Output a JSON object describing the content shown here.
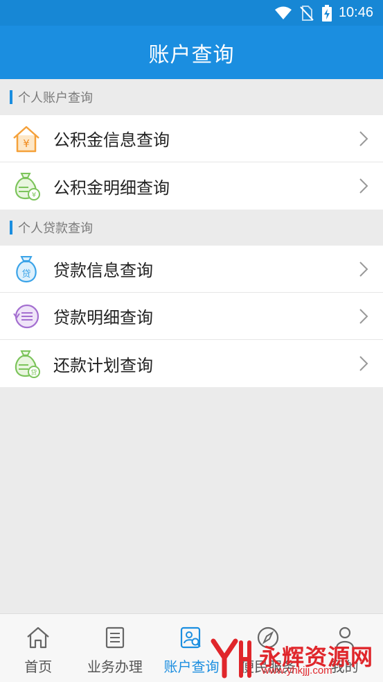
{
  "status_bar": {
    "time": "10:46",
    "icons": [
      "wifi-icon",
      "no-sim-icon",
      "battery-charging-icon"
    ]
  },
  "header": {
    "title": "账户查询"
  },
  "sections": [
    {
      "title": "个人账户查询",
      "items": [
        {
          "label": "公积金信息查询",
          "icon": "house-yuan-icon"
        },
        {
          "label": "公积金明细查询",
          "icon": "moneybag-yuan-icon"
        }
      ]
    },
    {
      "title": "个人贷款查询",
      "items": [
        {
          "label": "贷款信息查询",
          "icon": "loan-bag-icon"
        },
        {
          "label": "贷款明细查询",
          "icon": "list-circle-icon"
        },
        {
          "label": "还款计划查询",
          "icon": "moneybag-loan-icon"
        }
      ]
    }
  ],
  "tabbar": {
    "tabs": [
      {
        "label": "首页",
        "icon": "home-icon"
      },
      {
        "label": "业务办理",
        "icon": "document-icon"
      },
      {
        "label": "账户查询",
        "icon": "account-search-icon",
        "active": true
      },
      {
        "label": "便民服务",
        "icon": "compass-icon"
      },
      {
        "label": "我的",
        "icon": "user-icon"
      }
    ]
  },
  "watermark": {
    "text": "永辉资源网",
    "url": "www.yhkjjj.com"
  },
  "colors": {
    "primary": "#1b8ee0",
    "orange": "#f5a13a",
    "green": "#7cc45b",
    "purple": "#a46fd0",
    "blue_icon": "#3aa3e8"
  }
}
